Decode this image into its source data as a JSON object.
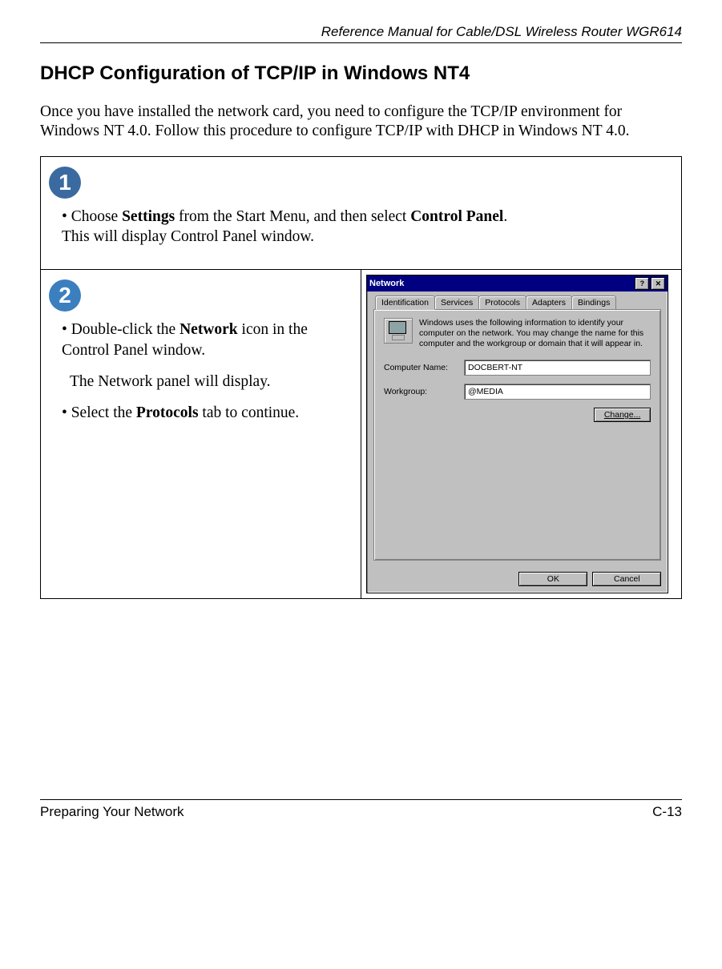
{
  "header": {
    "manual_title": "Reference Manual for Cable/DSL Wireless Router WGR614"
  },
  "section": {
    "title": "DHCP Configuration of TCP/IP in Windows NT4",
    "intro": "Once you have installed the network card, you need to configure the TCP/IP environment for Windows NT 4.0. Follow this procedure to configure TCP/IP with DHCP in Windows NT 4.0."
  },
  "steps": {
    "one": {
      "badge": "1",
      "line1_pre": "Choose ",
      "line1_b1": "Settings",
      "line1_mid": " from the Start Menu, and then select ",
      "line1_b2": "Control Panel",
      "line1_post": ".",
      "line2": "This will display Control Panel window."
    },
    "two": {
      "badge": "2",
      "p1_pre": "Double-click the ",
      "p1_b": "Network",
      "p1_post": " icon in the Control Panel window.",
      "p2": "The Network panel will display.",
      "p3_pre": "Select the ",
      "p3_b": "Protocols",
      "p3_post": " tab to continue."
    }
  },
  "dialog": {
    "title": "Network",
    "help_glyph": "?",
    "close_glyph": "✕",
    "tabs": [
      "Identification",
      "Services",
      "Protocols",
      "Adapters",
      "Bindings"
    ],
    "active_tab_index": 0,
    "info_text": "Windows uses the following information to identify your computer on the network. You may change the name for this computer and the workgroup or domain that it will appear in.",
    "computer_name_label": "Computer Name:",
    "computer_name_value": "DOCBERT-NT",
    "workgroup_label": "Workgroup:",
    "workgroup_value": "@MEDIA",
    "change_button": "Change...",
    "ok_button": "OK",
    "cancel_button": "Cancel"
  },
  "footer": {
    "left": "Preparing Your Network",
    "right": "C-13"
  }
}
